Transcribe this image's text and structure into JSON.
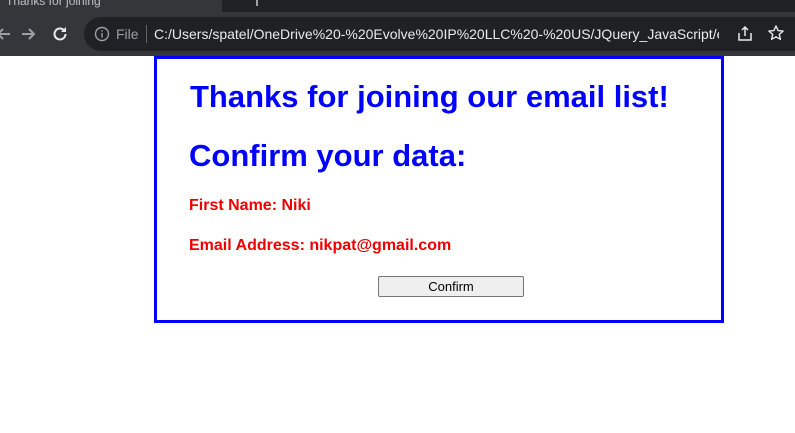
{
  "browser": {
    "tab_title": "Thanks for joining",
    "file_label": "File",
    "url": "C:/Users/spatel/OneDrive%20-%20Evolve%20IP%20LLC%20-%20US/JQuery_JavaScript/em...",
    "icons": [
      "forward-icon",
      "reload-icon",
      "info-icon",
      "share-icon",
      "star-icon"
    ]
  },
  "page": {
    "heading": "Thanks for joining our email list!",
    "subheading": "Confirm your data:",
    "first_name_line": "First Name: Niki",
    "email_line": "Email Address: nikpat@gmail.com",
    "confirm_label": "Confirm"
  },
  "colors": {
    "heading": "#0000ff",
    "fields": "#ee0000",
    "border": "#0000ff"
  }
}
